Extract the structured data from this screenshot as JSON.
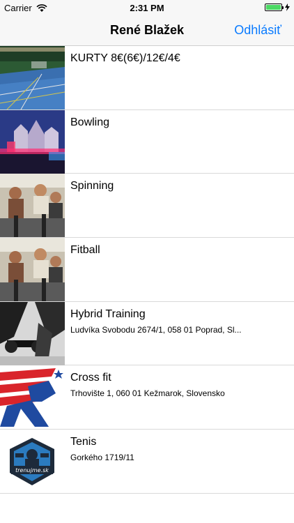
{
  "status_bar": {
    "carrier": "Carrier",
    "time": "2:31 PM"
  },
  "nav": {
    "title": "René Blažek",
    "logout_label": "Odhlásiť"
  },
  "colors": {
    "accent": "#0a7bff",
    "battery": "#4cd964"
  },
  "items": [
    {
      "title": "KURTY 8€(6€)/12€/4€",
      "subtitle": "",
      "icon": "court-photo"
    },
    {
      "title": "Bowling",
      "subtitle": "",
      "icon": "castle-photo"
    },
    {
      "title": "Spinning",
      "subtitle": "",
      "icon": "spinning-photo"
    },
    {
      "title": "Fitball",
      "subtitle": "",
      "icon": "spinning-photo"
    },
    {
      "title": "Hybrid Training",
      "subtitle": "Ludvíka Svobodu 2674/1, 058 01 Poprad, Sl...",
      "icon": "gym-photo"
    },
    {
      "title": "Cross fit",
      "subtitle": "Trhovište 1, 060 01 Kežmarok, Slovensko",
      "icon": "flag-logo"
    },
    {
      "title": "Tenis",
      "subtitle": "Gorkého 1719/11",
      "icon": "trenujme-logo"
    }
  ],
  "thumb_texts": {
    "trenujme": "trenujme.sk"
  }
}
